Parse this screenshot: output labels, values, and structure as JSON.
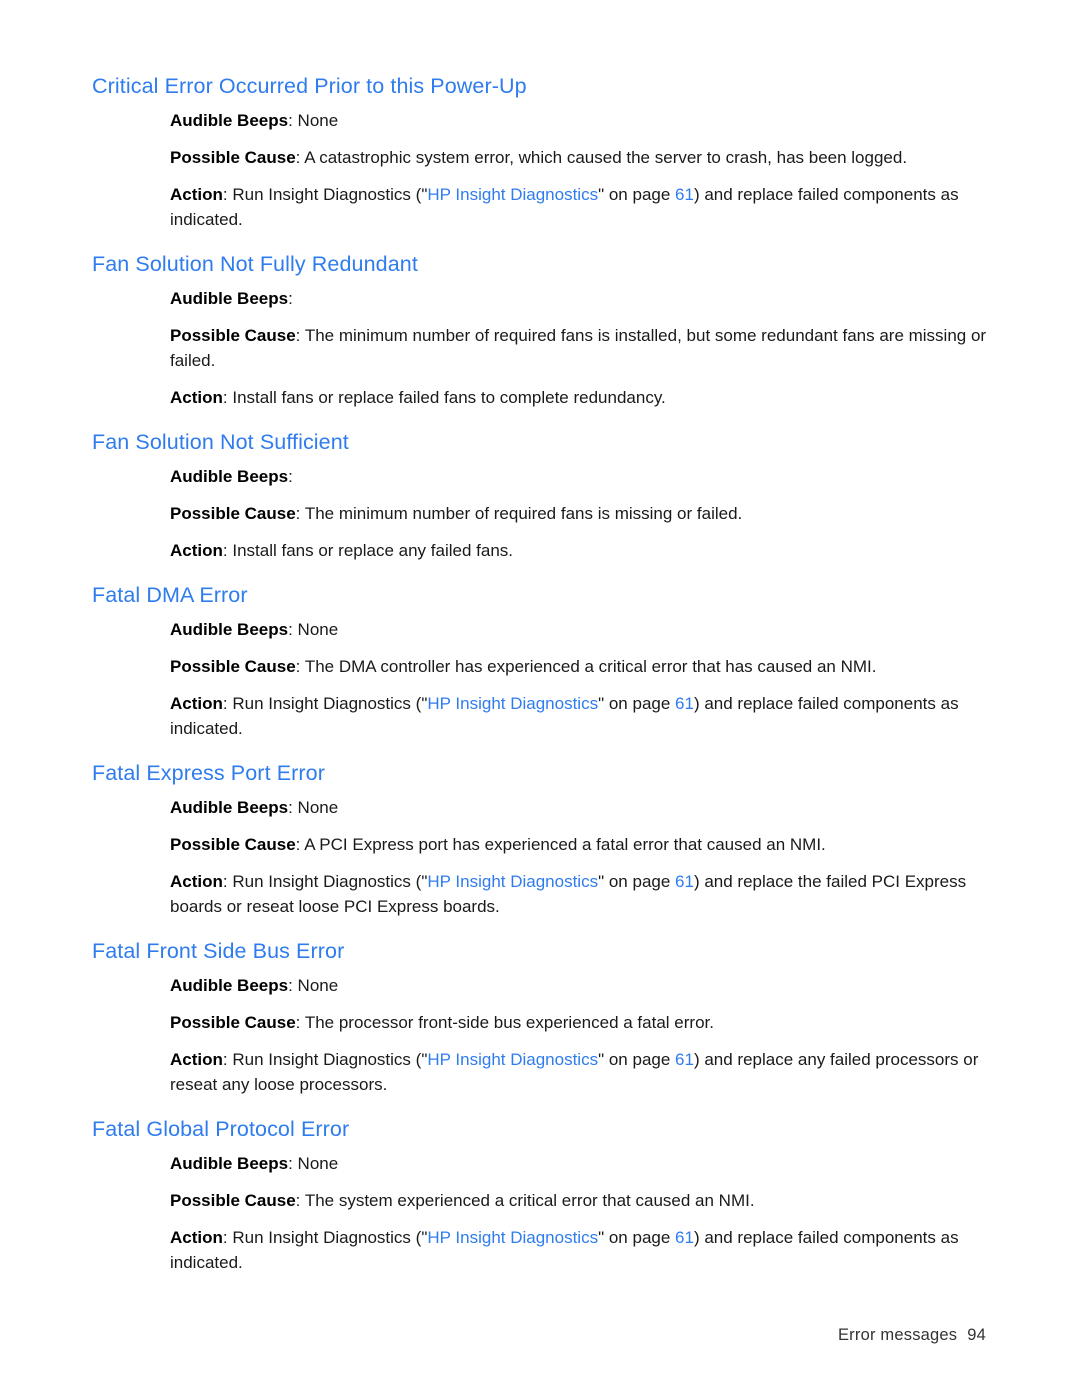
{
  "document": {
    "footer_label": "Error messages",
    "footer_page": "94",
    "heading_color": "#2f7cee",
    "link_color": "#2f7cee",
    "body_color": "#1a1a1a"
  },
  "labels": {
    "audible_beeps": "Audible Beeps",
    "possible_cause": "Possible Cause",
    "action": "Action",
    "colon": ": "
  },
  "link": {
    "insight_diagnostics": "HP Insight Diagnostics",
    "page_61": "61",
    "open_quote": "(\"",
    "close_quote": "\" on page ",
    "close_paren": ")"
  },
  "sections": [
    {
      "heading": "Critical Error Occurred Prior to this Power-Up",
      "audible_beeps": "None",
      "possible_cause": "A catastrophic system error, which caused the server to crash, has been logged.",
      "action_prefix": "Run Insight Diagnostics ",
      "action_suffix": " and replace failed components as indicated.",
      "has_link": true
    },
    {
      "heading": "Fan Solution Not Fully Redundant",
      "audible_beeps": "",
      "possible_cause": "The minimum number of required fans is installed, but some redundant fans are missing or failed.",
      "action_prefix": "Install fans or replace failed fans to complete redundancy.",
      "action_suffix": "",
      "has_link": false
    },
    {
      "heading": "Fan Solution Not Sufficient",
      "audible_beeps": "",
      "possible_cause": "The minimum number of required fans is missing or failed.",
      "action_prefix": "Install fans or replace any failed fans.",
      "action_suffix": "",
      "has_link": false
    },
    {
      "heading": "Fatal DMA Error",
      "audible_beeps": "None",
      "possible_cause": "The DMA controller has experienced a critical error that has caused an NMI.",
      "action_prefix": "Run Insight Diagnostics ",
      "action_suffix": " and replace failed components as indicated.",
      "has_link": true
    },
    {
      "heading": "Fatal Express Port Error",
      "audible_beeps": "None",
      "possible_cause": "A PCI Express port has experienced a fatal error that caused an NMI.",
      "action_prefix": "Run Insight Diagnostics ",
      "action_suffix": " and replace the failed PCI Express boards or reseat loose PCI Express boards.",
      "has_link": true
    },
    {
      "heading": "Fatal Front Side Bus Error",
      "audible_beeps": "None",
      "possible_cause": "The processor front-side bus experienced a fatal error.",
      "action_prefix": "Run Insight Diagnostics ",
      "action_suffix": " and replace any failed processors or reseat any loose processors.",
      "has_link": true
    },
    {
      "heading": "Fatal Global Protocol Error",
      "audible_beeps": "None",
      "possible_cause": "The system experienced a critical error that caused an NMI.",
      "action_prefix": "Run Insight Diagnostics ",
      "action_suffix": " and replace failed components as indicated.",
      "has_link": true
    }
  ]
}
